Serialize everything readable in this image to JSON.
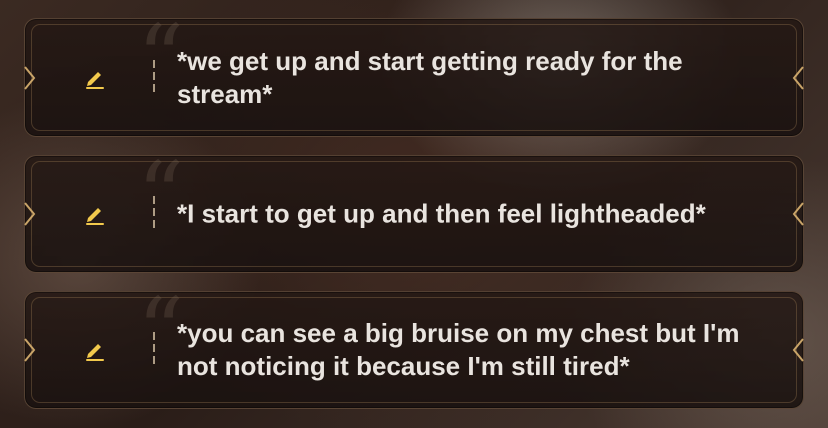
{
  "colors": {
    "accent_gold": "#c9a468",
    "edit_icon": "#f2c94c",
    "text": "#e9e4df"
  },
  "messages": [
    {
      "text": "*we get up and start getting ready for the stream*",
      "icon": "pencil-icon"
    },
    {
      "text": "*I start to get up and then feel lightheaded*",
      "icon": "pencil-icon"
    },
    {
      "text": "*you can see a big bruise on my chest but I'm not noticing it because I'm still tired*",
      "icon": "pencil-icon"
    }
  ]
}
